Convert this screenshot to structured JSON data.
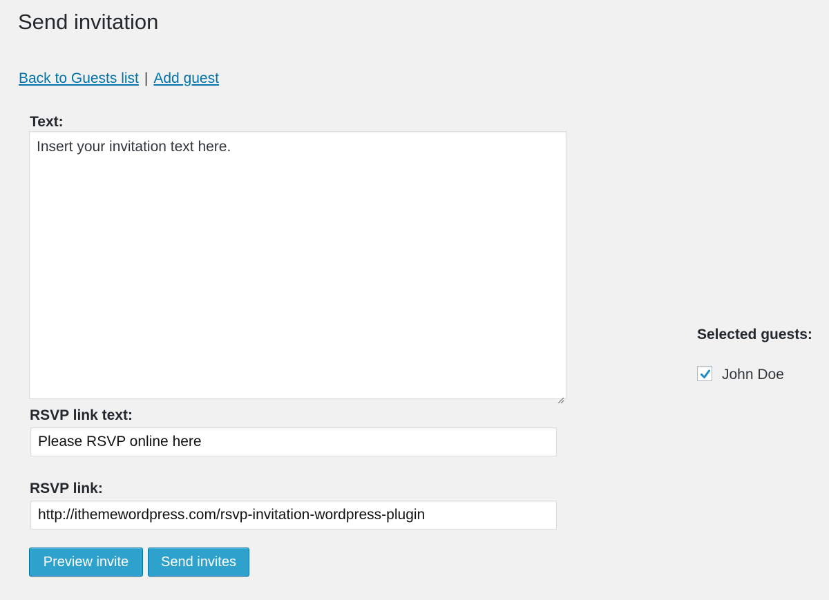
{
  "page": {
    "title": "Send invitation"
  },
  "nav": {
    "back_label": "Back to Guests list",
    "separator": "|",
    "add_label": "Add guest"
  },
  "form": {
    "text_label": "Text:",
    "text_value": "Insert your invitation text here.",
    "rsvp_text_label": "RSVP link text:",
    "rsvp_text_value": "Please RSVP online here",
    "rsvp_link_label": "RSVP link:",
    "rsvp_link_value": "http://ithemewordpress.com/rsvp-invitation-wordpress-plugin"
  },
  "buttons": {
    "preview_label": "Preview invite",
    "send_label": "Send invites"
  },
  "guests": {
    "label": "Selected guests:",
    "items": [
      {
        "name": "John Doe",
        "checked": true
      }
    ]
  },
  "colors": {
    "link": "#0073aa",
    "button": "#2ea2cc",
    "checkmark": "#1e8cbe",
    "background": "#f1f1f1"
  },
  "icons": {
    "checkbox_checked": "checkmark-icon",
    "textarea_resize": "resize-grip-icon"
  }
}
